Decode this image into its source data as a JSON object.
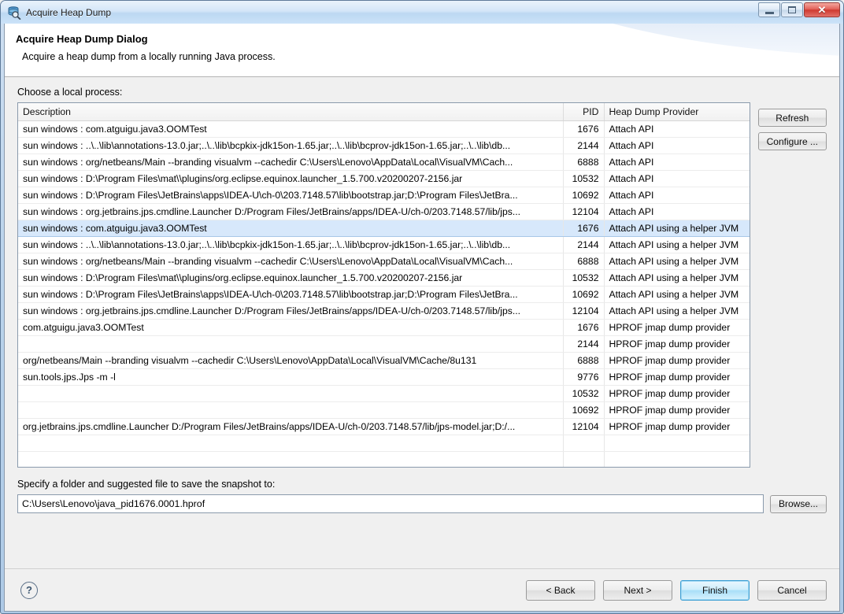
{
  "window": {
    "title": "Acquire Heap Dump",
    "icon": "heap-dump-search-icon",
    "controls": {
      "minimize": "–",
      "maximize": "□",
      "close": "✕"
    }
  },
  "banner": {
    "title": "Acquire Heap Dump Dialog",
    "subtitle": "Acquire a heap dump from a locally running Java process."
  },
  "process_section": {
    "label": "Choose a local process:",
    "columns": [
      "Description",
      "PID",
      "Heap Dump Provider"
    ],
    "rows": [
      {
        "description": "sun windows : com.atguigu.java3.OOMTest",
        "pid": "1676",
        "provider": "Attach API",
        "selected": false
      },
      {
        "description": "sun windows : ..\\..\\lib\\annotations-13.0.jar;..\\..\\lib\\bcpkix-jdk15on-1.65.jar;..\\..\\lib\\bcprov-jdk15on-1.65.jar;..\\..\\lib\\db...",
        "pid": "2144",
        "provider": "Attach API",
        "selected": false
      },
      {
        "description": "sun windows : org/netbeans/Main --branding visualvm --cachedir C:\\Users\\Lenovo\\AppData\\Local\\VisualVM\\Cach...",
        "pid": "6888",
        "provider": "Attach API",
        "selected": false
      },
      {
        "description": "sun windows : D:\\Program Files\\mat\\\\plugins/org.eclipse.equinox.launcher_1.5.700.v20200207-2156.jar",
        "pid": "10532",
        "provider": "Attach API",
        "selected": false
      },
      {
        "description": "sun windows : D:\\Program Files\\JetBrains\\apps\\IDEA-U\\ch-0\\203.7148.57\\lib\\bootstrap.jar;D:\\Program Files\\JetBra...",
        "pid": "10692",
        "provider": "Attach API",
        "selected": false
      },
      {
        "description": "sun windows : org.jetbrains.jps.cmdline.Launcher D:/Program Files/JetBrains/apps/IDEA-U/ch-0/203.7148.57/lib/jps...",
        "pid": "12104",
        "provider": "Attach API",
        "selected": false
      },
      {
        "description": "sun windows : com.atguigu.java3.OOMTest",
        "pid": "1676",
        "provider": "Attach API using a helper JVM",
        "selected": true
      },
      {
        "description": "sun windows : ..\\..\\lib\\annotations-13.0.jar;..\\..\\lib\\bcpkix-jdk15on-1.65.jar;..\\..\\lib\\bcprov-jdk15on-1.65.jar;..\\..\\lib\\db...",
        "pid": "2144",
        "provider": "Attach API using a helper JVM",
        "selected": false
      },
      {
        "description": "sun windows : org/netbeans/Main --branding visualvm --cachedir C:\\Users\\Lenovo\\AppData\\Local\\VisualVM\\Cach...",
        "pid": "6888",
        "provider": "Attach API using a helper JVM",
        "selected": false
      },
      {
        "description": "sun windows : D:\\Program Files\\mat\\\\plugins/org.eclipse.equinox.launcher_1.5.700.v20200207-2156.jar",
        "pid": "10532",
        "provider": "Attach API using a helper JVM",
        "selected": false
      },
      {
        "description": "sun windows : D:\\Program Files\\JetBrains\\apps\\IDEA-U\\ch-0\\203.7148.57\\lib\\bootstrap.jar;D:\\Program Files\\JetBra...",
        "pid": "10692",
        "provider": "Attach API using a helper JVM",
        "selected": false
      },
      {
        "description": "sun windows : org.jetbrains.jps.cmdline.Launcher D:/Program Files/JetBrains/apps/IDEA-U/ch-0/203.7148.57/lib/jps...",
        "pid": "12104",
        "provider": "Attach API using a helper JVM",
        "selected": false
      },
      {
        "description": "com.atguigu.java3.OOMTest",
        "pid": "1676",
        "provider": "HPROF jmap dump provider",
        "selected": false
      },
      {
        "description": "",
        "pid": "2144",
        "provider": "HPROF jmap dump provider",
        "selected": false
      },
      {
        "description": "org/netbeans/Main --branding visualvm --cachedir C:\\Users\\Lenovo\\AppData\\Local\\VisualVM\\Cache/8u131",
        "pid": "6888",
        "provider": "HPROF jmap dump provider",
        "selected": false
      },
      {
        "description": "sun.tools.jps.Jps -m -l",
        "pid": "9776",
        "provider": "HPROF jmap dump provider",
        "selected": false
      },
      {
        "description": "",
        "pid": "10532",
        "provider": "HPROF jmap dump provider",
        "selected": false
      },
      {
        "description": "",
        "pid": "10692",
        "provider": "HPROF jmap dump provider",
        "selected": false
      },
      {
        "description": "org.jetbrains.jps.cmdline.Launcher D:/Program Files/JetBrains/apps/IDEA-U/ch-0/203.7148.57/lib/jps-model.jar;D:/...",
        "pid": "12104",
        "provider": "HPROF jmap dump provider",
        "selected": false
      },
      {
        "description": "",
        "pid": "",
        "provider": "",
        "selected": false
      },
      {
        "description": "",
        "pid": "",
        "provider": "",
        "selected": false
      }
    ],
    "refresh_label": "Refresh",
    "configure_label": "Configure ..."
  },
  "save_section": {
    "label": "Specify a folder and suggested file to save the snapshot to:",
    "path_value": "C:\\Users\\Lenovo\\java_pid1676.0001.hprof",
    "path_placeholder": "",
    "browse_label": "Browse..."
  },
  "footer": {
    "help_label": "?",
    "back_label": "< Back",
    "next_label": "Next >",
    "finish_label": "Finish",
    "cancel_label": "Cancel"
  },
  "colors": {
    "selection": "#d7e8fb",
    "default_button_border": "#3c9fd4",
    "close_button": "#cf3a30"
  }
}
